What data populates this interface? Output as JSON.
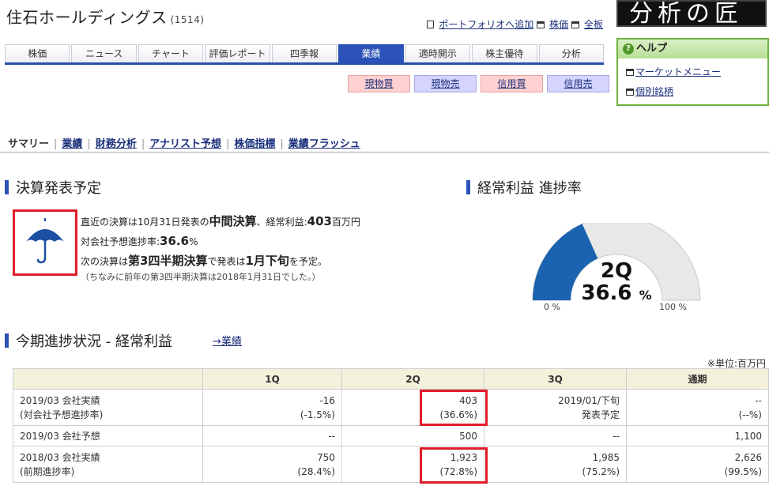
{
  "header": {
    "company_name": "住石ホールディングス",
    "company_code": "(1514)",
    "links": [
      "ポートフォリオへ追加",
      "株価",
      "全板"
    ],
    "logo_text": "分析の匠"
  },
  "tabs": [
    {
      "label": "株価",
      "active": false
    },
    {
      "label": "ニュース",
      "active": false
    },
    {
      "label": "チャート",
      "active": false
    },
    {
      "label": "評価レポート",
      "active": false
    },
    {
      "label": "四季報",
      "active": false
    },
    {
      "label": "業績",
      "active": true
    },
    {
      "label": "適時開示",
      "active": false
    },
    {
      "label": "株主優待",
      "active": false
    },
    {
      "label": "分析",
      "active": false
    }
  ],
  "trade_buttons": [
    "現物買",
    "現物売",
    "信用買",
    "信用売"
  ],
  "help": {
    "title": "ヘルプ",
    "links": [
      "マーケットメニュー",
      "個別銘柄"
    ]
  },
  "subnav": {
    "current": "サマリー",
    "links": [
      "業績",
      "財務分析",
      "アナリスト予想",
      "株価指標",
      "業績フラッシュ"
    ]
  },
  "kessan": {
    "title": "決算発表予定",
    "icon": "umbrella-icon",
    "line1_a": "直近の決算は",
    "line1_date": "10月31日",
    "line1_b": "発表の",
    "line1_type": "中間決算",
    "line1_c": "、経常利益:",
    "line1_value": "403",
    "line1_unit": "百万円",
    "line2_a": "対会社予想進捗率:",
    "line2_value": "36.6",
    "line2_unit": "%",
    "line3_a": "次の決算は",
    "line3_type": "第3四半期決算",
    "line3_b": "で発表は",
    "line3_when": "1月下旬",
    "line3_c": "を予定。",
    "note": "（ちなみに前年の第3四半期決算は2018年1月31日でした。）"
  },
  "progress": {
    "title": "経常利益 進捗率",
    "quarter": "2Q",
    "value": "36.6",
    "unit": "%",
    "percent": 36.6,
    "min_label": "0 %",
    "max_label": "100 %",
    "fill_color": "#1a63b0",
    "track_color": "#e8e8e8"
  },
  "current": {
    "title": "今期進捗状況 - 経常利益",
    "link": "→業績",
    "unit_note": "※単位:百万円",
    "headers": [
      "",
      "1Q",
      "2Q",
      "3Q",
      "通期"
    ],
    "rows": [
      {
        "label1": "2019/03 会社実績",
        "label2": "(対会社予想進捗率)",
        "cells": [
          [
            "-16",
            "(-1.5%)"
          ],
          [
            "403",
            "(36.6%)"
          ],
          [
            "2019/01/下旬",
            "発表予定"
          ],
          [
            "--",
            "(--%)"
          ]
        ]
      },
      {
        "label1": "2019/03 会社予想",
        "label2": "",
        "cells": [
          [
            "--",
            ""
          ],
          [
            "500",
            ""
          ],
          [
            "--",
            ""
          ],
          [
            "1,100",
            ""
          ]
        ]
      },
      {
        "label1": "2018/03 会社実績",
        "label2": "(前期進捗率)",
        "cells": [
          [
            "750",
            "(28.4%)"
          ],
          [
            "1,923",
            "(72.8%)"
          ],
          [
            "1,985",
            "(75.2%)"
          ],
          [
            "2,626",
            "(99.5%)"
          ]
        ]
      }
    ]
  },
  "accent_colors": {
    "nav_blue": "#2b52b8",
    "highlight_red": "#e01d2a",
    "help_green": "#6db13c"
  }
}
